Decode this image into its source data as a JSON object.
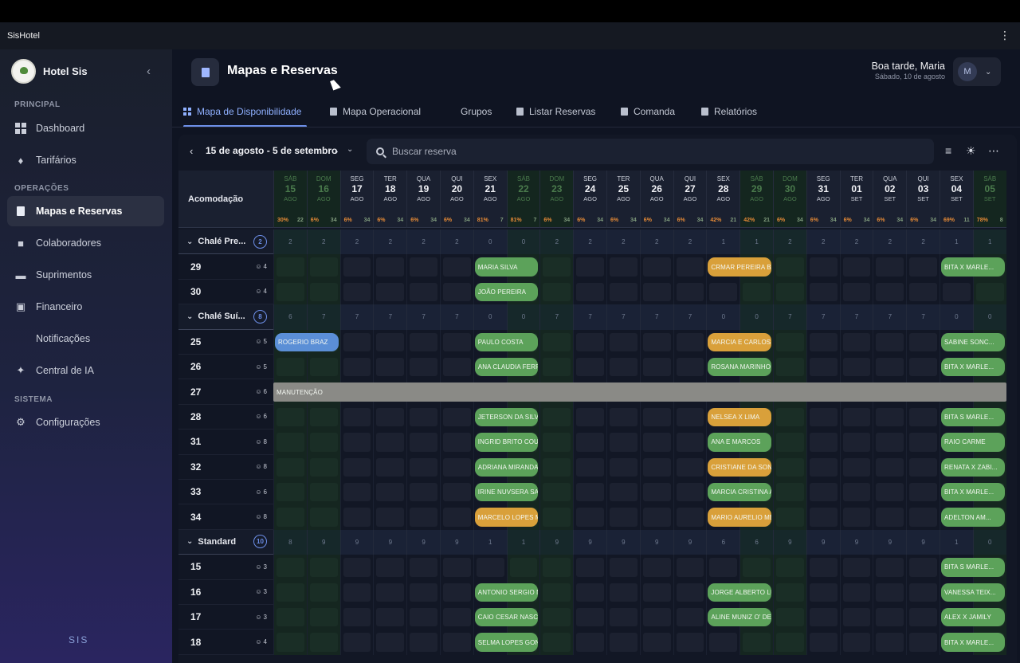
{
  "app": {
    "title": "SisHotel"
  },
  "sidebar": {
    "brand": "Hotel Sis",
    "sections": [
      {
        "label": "PRINCIPAL",
        "items": [
          {
            "label": "Dashboard",
            "icon": "grid-icon"
          },
          {
            "label": "Tarifários",
            "icon": "tag-icon"
          }
        ]
      },
      {
        "label": "OPERAÇÕES",
        "items": [
          {
            "label": "Mapas e Reservas",
            "icon": "map-icon",
            "active": true
          },
          {
            "label": "Colaboradores",
            "icon": "people-icon"
          },
          {
            "label": "Suprimentos",
            "icon": "truck-icon"
          },
          {
            "label": "Financeiro",
            "icon": "finance-icon"
          },
          {
            "label": "Notificações",
            "icon": ""
          },
          {
            "label": "Central de IA",
            "icon": "sparkle-icon"
          }
        ]
      },
      {
        "label": "SISTEMA",
        "items": [
          {
            "label": "Configurações",
            "icon": "gear-icon"
          }
        ]
      }
    ],
    "footer_logo": "SIS"
  },
  "header": {
    "title": "Mapas e Reservas",
    "greeting": "Boa tarde, Maria",
    "date": "Sábado, 10 de agosto",
    "avatar_initial": "M"
  },
  "tabs": [
    {
      "label": "Mapa de Disponibilidade",
      "active": true
    },
    {
      "label": "Mapa Operacional"
    },
    {
      "label": "Grupos"
    },
    {
      "label": "Listar Reservas"
    },
    {
      "label": "Comanda"
    },
    {
      "label": "Relatórios"
    }
  ],
  "toolbar": {
    "range": "15 de agosto - 5 de setembro",
    "search_placeholder": "Buscar reserva"
  },
  "calendar": {
    "room_header": "Acomodação",
    "days": [
      {
        "wd": "SÁB",
        "d": "15",
        "m": "AGO",
        "occ": "30%",
        "n": "22",
        "weekend": true
      },
      {
        "wd": "DOM",
        "d": "16",
        "m": "AGO",
        "occ": "6%",
        "n": "34",
        "weekend": true
      },
      {
        "wd": "SEG",
        "d": "17",
        "m": "AGO",
        "occ": "6%",
        "n": "34"
      },
      {
        "wd": "TER",
        "d": "18",
        "m": "AGO",
        "occ": "6%",
        "n": "34"
      },
      {
        "wd": "QUA",
        "d": "19",
        "m": "AGO",
        "occ": "6%",
        "n": "34"
      },
      {
        "wd": "QUI",
        "d": "20",
        "m": "AGO",
        "occ": "6%",
        "n": "34"
      },
      {
        "wd": "SEX",
        "d": "21",
        "m": "AGO",
        "occ": "81%",
        "n": "7"
      },
      {
        "wd": "SÁB",
        "d": "22",
        "m": "AGO",
        "occ": "81%",
        "n": "7",
        "weekend": true
      },
      {
        "wd": "DOM",
        "d": "23",
        "m": "AGO",
        "occ": "6%",
        "n": "34",
        "weekend": true
      },
      {
        "wd": "SEG",
        "d": "24",
        "m": "AGO",
        "occ": "6%",
        "n": "34"
      },
      {
        "wd": "TER",
        "d": "25",
        "m": "AGO",
        "occ": "6%",
        "n": "34"
      },
      {
        "wd": "QUA",
        "d": "26",
        "m": "AGO",
        "occ": "6%",
        "n": "34"
      },
      {
        "wd": "QUI",
        "d": "27",
        "m": "AGO",
        "occ": "6%",
        "n": "34"
      },
      {
        "wd": "SEX",
        "d": "28",
        "m": "AGO",
        "occ": "42%",
        "n": "21"
      },
      {
        "wd": "SÁB",
        "d": "29",
        "m": "AGO",
        "occ": "42%",
        "n": "21",
        "weekend": true
      },
      {
        "wd": "DOM",
        "d": "30",
        "m": "AGO",
        "occ": "6%",
        "n": "34",
        "weekend": true
      },
      {
        "wd": "SEG",
        "d": "31",
        "m": "AGO",
        "occ": "6%",
        "n": "34"
      },
      {
        "wd": "TER",
        "d": "01",
        "m": "SET",
        "occ": "6%",
        "n": "34"
      },
      {
        "wd": "QUA",
        "d": "02",
        "m": "SET",
        "occ": "6%",
        "n": "34"
      },
      {
        "wd": "QUI",
        "d": "03",
        "m": "SET",
        "occ": "6%",
        "n": "34"
      },
      {
        "wd": "SEX",
        "d": "04",
        "m": "SET",
        "occ": "69%",
        "n": "11"
      },
      {
        "wd": "SÁB",
        "d": "05",
        "m": "SET",
        "occ": "78%",
        "n": "8",
        "weekend": true
      }
    ],
    "groups": [
      {
        "name": "Chalé Pre...",
        "count": "2",
        "avail": [
          "2",
          "2",
          "2",
          "2",
          "2",
          "2",
          "0",
          "0",
          "2",
          "2",
          "2",
          "2",
          "2",
          "1",
          "1",
          "2",
          "2",
          "2",
          "2",
          "2",
          "1",
          "1"
        ],
        "rooms": [
          {
            "num": "29",
            "cap": "4",
            "bookings": [
              {
                "start": 6,
                "len": 2,
                "name": "MARIA SILVA",
                "color": "green"
              },
              {
                "start": 13,
                "len": 2,
                "name": "CRMAR PEREIRA BA...",
                "color": "orange"
              },
              {
                "start": 20,
                "len": 2,
                "name": "BITA X MARLE...",
                "color": "green"
              }
            ]
          },
          {
            "num": "30",
            "cap": "4",
            "bookings": [
              {
                "start": 6,
                "len": 2,
                "name": "JOÃO PEREIRA",
                "color": "green"
              }
            ]
          }
        ]
      },
      {
        "name": "Chalé Suí...",
        "count": "8",
        "avail": [
          "6",
          "7",
          "7",
          "7",
          "7",
          "7",
          "0",
          "0",
          "7",
          "7",
          "7",
          "7",
          "7",
          "0",
          "0",
          "7",
          "7",
          "7",
          "7",
          "7",
          "0",
          "0"
        ],
        "rooms": [
          {
            "num": "25",
            "cap": "5",
            "bookings": [
              {
                "start": 0,
                "len": 2,
                "name": "ROGERIO BRAZ",
                "color": "blue"
              },
              {
                "start": 6,
                "len": 2,
                "name": "PAULO COSTA",
                "color": "green"
              },
              {
                "start": 13,
                "len": 2,
                "name": "MARCIA E CARLOS",
                "color": "orange"
              },
              {
                "start": 20,
                "len": 2,
                "name": "SABINE SONC...",
                "color": "green"
              }
            ]
          },
          {
            "num": "26",
            "cap": "5",
            "bookings": [
              {
                "start": 6,
                "len": 2,
                "name": "ANA CLAUDIA FERRE",
                "color": "green"
              },
              {
                "start": 13,
                "len": 2,
                "name": "ROSANA MARINHO S...",
                "color": "green"
              },
              {
                "start": 20,
                "len": 2,
                "name": "BITA X MARLE...",
                "color": "green"
              }
            ]
          },
          {
            "num": "27",
            "cap": "6",
            "bookings": [
              {
                "start": 0,
                "len": 22,
                "name": "MANUTENÇÃO",
                "color": "gray"
              }
            ]
          },
          {
            "num": "28",
            "cap": "6",
            "bookings": [
              {
                "start": 6,
                "len": 2,
                "name": "JETERSON DA SILVA ...",
                "color": "green"
              },
              {
                "start": 13,
                "len": 2,
                "name": "NELSEA X LIMA",
                "color": "orange"
              },
              {
                "start": 20,
                "len": 2,
                "name": "BITA S MARLE...",
                "color": "green"
              }
            ]
          },
          {
            "num": "31",
            "cap": "8",
            "bookings": [
              {
                "start": 6,
                "len": 2,
                "name": "INGRID BRITO COURA",
                "color": "green"
              },
              {
                "start": 13,
                "len": 2,
                "name": "ANA E MARCOS",
                "color": "green"
              },
              {
                "start": 20,
                "len": 2,
                "name": "RAIO CARME",
                "color": "green"
              }
            ]
          },
          {
            "num": "32",
            "cap": "8",
            "bookings": [
              {
                "start": 6,
                "len": 2,
                "name": "ADRIANA MIRANDA",
                "color": "green"
              },
              {
                "start": 13,
                "len": 2,
                "name": "CRISTIANE DA SONS...",
                "color": "orange"
              },
              {
                "start": 20,
                "len": 2,
                "name": "RENATA X ZABI...",
                "color": "green"
              }
            ]
          },
          {
            "num": "33",
            "cap": "6",
            "bookings": [
              {
                "start": 6,
                "len": 2,
                "name": "IRINE NUVSERA SA G...",
                "color": "green"
              },
              {
                "start": 13,
                "len": 2,
                "name": "MARCIA CRISTINA A...",
                "color": "green"
              },
              {
                "start": 20,
                "len": 2,
                "name": "BITA X MARLE...",
                "color": "green"
              }
            ]
          },
          {
            "num": "34",
            "cap": "8",
            "bookings": [
              {
                "start": 6,
                "len": 2,
                "name": "MARCELO LOPES MO...",
                "color": "orange"
              },
              {
                "start": 13,
                "len": 2,
                "name": "MARIO AURELIO ME...",
                "color": "orange"
              },
              {
                "start": 20,
                "len": 2,
                "name": "ADELTON AM...",
                "color": "green"
              }
            ]
          }
        ]
      },
      {
        "name": "Standard",
        "count": "10",
        "avail": [
          "8",
          "9",
          "9",
          "9",
          "9",
          "9",
          "1",
          "1",
          "9",
          "9",
          "9",
          "9",
          "9",
          "6",
          "6",
          "9",
          "9",
          "9",
          "9",
          "9",
          "1",
          "0"
        ],
        "rooms": [
          {
            "num": "15",
            "cap": "3",
            "bookings": [
              {
                "start": 20,
                "len": 2,
                "name": "BITA S MARLE...",
                "color": "green"
              }
            ]
          },
          {
            "num": "16",
            "cap": "3",
            "bookings": [
              {
                "start": 6,
                "len": 2,
                "name": "ANTONIO SERGIO NA...",
                "color": "green"
              },
              {
                "start": 13,
                "len": 2,
                "name": "JORGE ALBERTO LUI...",
                "color": "green"
              },
              {
                "start": 20,
                "len": 2,
                "name": "VANESSA TEIX...",
                "color": "green"
              }
            ]
          },
          {
            "num": "17",
            "cap": "3",
            "bookings": [
              {
                "start": 6,
                "len": 2,
                "name": "CAIO CESAR NASCIM...",
                "color": "green"
              },
              {
                "start": 13,
                "len": 2,
                "name": "ALINE MUNIZ O' DE A...",
                "color": "green"
              },
              {
                "start": 20,
                "len": 2,
                "name": "ALEX X JAMILY",
                "color": "green"
              }
            ]
          },
          {
            "num": "18",
            "cap": "4",
            "bookings": [
              {
                "start": 6,
                "len": 2,
                "name": "SELMA LOPES GONC...",
                "color": "green"
              },
              {
                "start": 20,
                "len": 2,
                "name": "BITA X MARLE...",
                "color": "green"
              }
            ]
          }
        ]
      }
    ]
  },
  "colors": {
    "accent": "#6d8fe8",
    "booking_green": "#5ca25a",
    "booking_orange": "#d9a03a",
    "booking_blue": "#5b8fd6",
    "maintenance": "#8a8a86",
    "occupancy_text": "#e58a36",
    "available_text": "#7f9a7c"
  }
}
